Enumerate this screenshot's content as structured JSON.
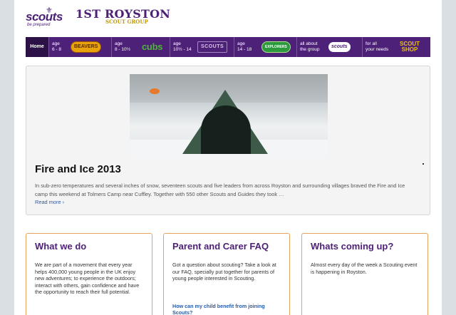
{
  "header": {
    "logo_word": "scouts",
    "logo_tagline": "be prepared",
    "group_title": "1ST ROYSTON",
    "group_subtitle": "SCOUT GROUP"
  },
  "nav": {
    "home": "Home",
    "items": [
      {
        "label_line1": "age",
        "label_line2": "6 - 8",
        "badge": "BEAVERS"
      },
      {
        "label_line1": "age",
        "label_line2": "8 - 10½",
        "badge": "cubs"
      },
      {
        "label_line1": "age",
        "label_line2": "10½ - 14",
        "badge": "SCOUTS"
      },
      {
        "label_line1": "age",
        "label_line2": "14 - 18",
        "badge": "EXPLORERS"
      },
      {
        "label_line1": "all about",
        "label_line2": "the group",
        "badge": "scouts"
      },
      {
        "label_line1": "for all",
        "label_line2": "your needs",
        "badge_line1": "SCOUT",
        "badge_line2": "SHOP"
      }
    ]
  },
  "featured": {
    "title": "Fire and Ice 2013",
    "text": "In sub-zero temperatures and several inches of snow, seventeen scouts and five leaders from across Royston and surrounding villages braved the Fire and Ice camp this weekend at Tolmers Camp near Cuffley. Together with 550 other Scouts and Guides they took …",
    "read_more": "Read more ›"
  },
  "cards": [
    {
      "title": "What we do",
      "text": "We are part of a movement that every year helps 400,000 young people in the UK enjoy new adventures; to experience the outdoors; interact with others, gain confidence and have the opportunity to reach their full potential."
    },
    {
      "title": "Parent and Carer FAQ",
      "text": "Got a question about scouting? Take a look at our FAQ, specially put together for parents of young people interested in Scouting.",
      "link": "How can my child benefit from joining Scouts?"
    },
    {
      "title": "Whats coming up?",
      "text": "Almost every day of the week a Scouting event is happening in Royston."
    }
  ],
  "colors": {
    "brand_purple": "#4d2177",
    "card_border": "#e8a35c",
    "link_blue": "#2a5ba8"
  }
}
